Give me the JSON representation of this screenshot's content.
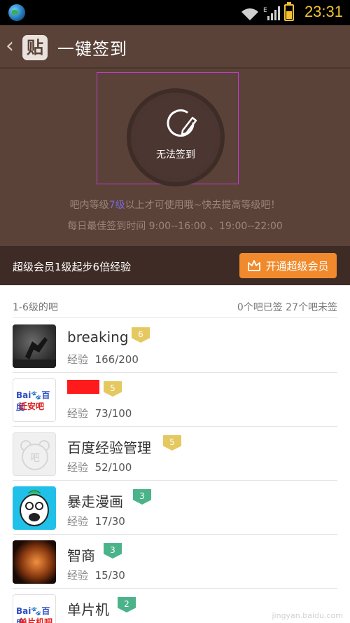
{
  "status_bar": {
    "time": "23:31",
    "network_label": "E"
  },
  "header": {
    "title": "一键签到",
    "logo_text": "贴"
  },
  "sign": {
    "button_label": "无法签到",
    "notice_prefix": "吧内等级",
    "notice_level": "7级",
    "notice_suffix": "以上才可使用哦~快去提高等级吧！",
    "best_time": "每日最佳签到时间  9:00--16:00 、19:00--22:00"
  },
  "member": {
    "text": "超级会员1级起步6倍经验",
    "button_label": "开通超级会员"
  },
  "list": {
    "header_left": "1-6级的吧",
    "header_right": "0个吧已签 27个吧未签",
    "exp_label": "经验",
    "items": [
      {
        "name": "breaking",
        "level": "6",
        "exp": "166/200",
        "badge_color": "#e5c860"
      },
      {
        "name": "",
        "level": "5",
        "exp": "73/100",
        "badge_color": "#e5c860"
      },
      {
        "name": "百度经验管理",
        "level": "5",
        "exp": "52/100",
        "badge_color": "#e5c860"
      },
      {
        "name": "暴走漫画",
        "level": "3",
        "exp": "17/30",
        "badge_color": "#4bb38a"
      },
      {
        "name": "智商",
        "level": "3",
        "exp": "15/30",
        "badge_color": "#4bb38a"
      },
      {
        "name": "单片机",
        "level": "2",
        "exp": "",
        "badge_color": "#4bb38a"
      }
    ]
  },
  "avatars": {
    "baidu_text": "Bai",
    "baidu_cn": "百度",
    "baidu_sub_1": "迁安吧",
    "baidu_sub_2": "单片机吧",
    "ba_icon": "吧"
  },
  "watermark": "jingyan.baidu.com"
}
